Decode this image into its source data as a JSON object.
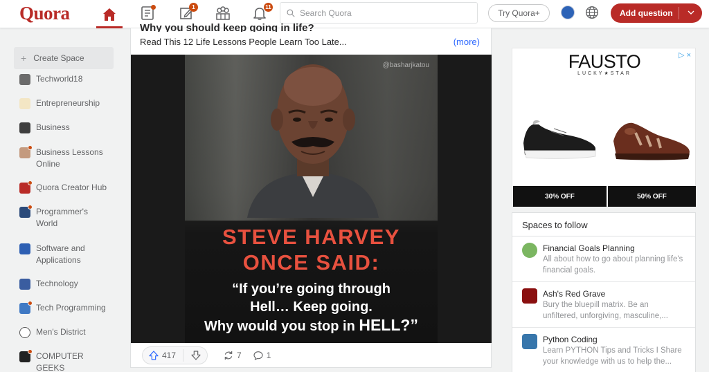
{
  "header": {
    "logo": "Quora",
    "notif_badges": {
      "answer": "1",
      "notifications": "11"
    },
    "search_placeholder": "Search Quora",
    "try_label": "Try Quora+",
    "add_question_label": "Add question"
  },
  "sidebar": {
    "create_space": "Create Space",
    "items": [
      {
        "label": "Techworld18",
        "icon": "techworld-icon",
        "color": "#6b6b6b",
        "dot": false
      },
      {
        "label": "Entrepreneurship",
        "icon": "entrepreneurship-icon",
        "color": "#f3e6c4",
        "dot": false
      },
      {
        "label": "Business",
        "icon": "business-icon",
        "color": "#3d3d3d",
        "dot": false
      },
      {
        "label": "Business Lessons Online",
        "icon": "business-lessons-icon",
        "color": "#c49a7e",
        "dot": true
      },
      {
        "label": "Quora Creator Hub",
        "icon": "creator-hub-icon",
        "color": "#b92b27",
        "dot": true
      },
      {
        "label": "Programmer's World",
        "icon": "programmers-world-icon",
        "color": "#2b4a7a",
        "dot": true
      },
      {
        "label": "Software and Applications",
        "icon": "software-icon",
        "color": "#2d5fb3",
        "dot": false
      },
      {
        "label": "Technology",
        "icon": "technology-icon",
        "color": "#3a5da0",
        "dot": false
      },
      {
        "label": "Tech Programming",
        "icon": "tech-programming-icon",
        "color": "#3f79c4",
        "dot": true
      },
      {
        "label": "Men's District",
        "icon": "mens-district-icon",
        "color": "#ffffff",
        "dot": false
      },
      {
        "label": "COMPUTER GEEKS",
        "icon": "computer-geeks-icon",
        "color": "#222222",
        "dot": true
      }
    ]
  },
  "post": {
    "title_cut": "Why you should keep going in life?",
    "teaser": "Read This 12 Life Lessons People Learn Too Late...",
    "more_label": "(more)",
    "image": {
      "handle": "@basharjkatou",
      "headline_line1": "STEVE HARVEY",
      "headline_line2": "ONCE SAID:",
      "quote_line1": "“If you’re going through",
      "quote_line2": "Hell… Keep going.",
      "quote_line3_a": "Why would you stop in ",
      "quote_line3_b": "HELL?”"
    },
    "actions": {
      "upvotes": "417",
      "shares": "7",
      "comments": "1"
    }
  },
  "ad": {
    "brand": "FAUSTO",
    "sub": "LUCKY★STAR",
    "adchoices": "▷ ×",
    "offer_left": "30% OFF",
    "offer_right": "50% OFF"
  },
  "spaces_to_follow": {
    "title": "Spaces to follow",
    "items": [
      {
        "name": "Financial Goals Planning",
        "desc": "All about how to go about planning life's financial goals.",
        "color": "#7bb661"
      },
      {
        "name": "Ash's Red Grave",
        "desc": "Bury the bluepill matrix. Be an unfiltered, unforgiving, masculine,...",
        "color": "#8a0f0f"
      },
      {
        "name": "Python Coding",
        "desc": "Learn PYTHON Tips and Tricks I Share your knowledge with us to help the...",
        "color": "#3776ab"
      }
    ]
  },
  "colors": {
    "brand": "#b92b27",
    "headline": "#e8513f",
    "link": "#2e69ff"
  }
}
